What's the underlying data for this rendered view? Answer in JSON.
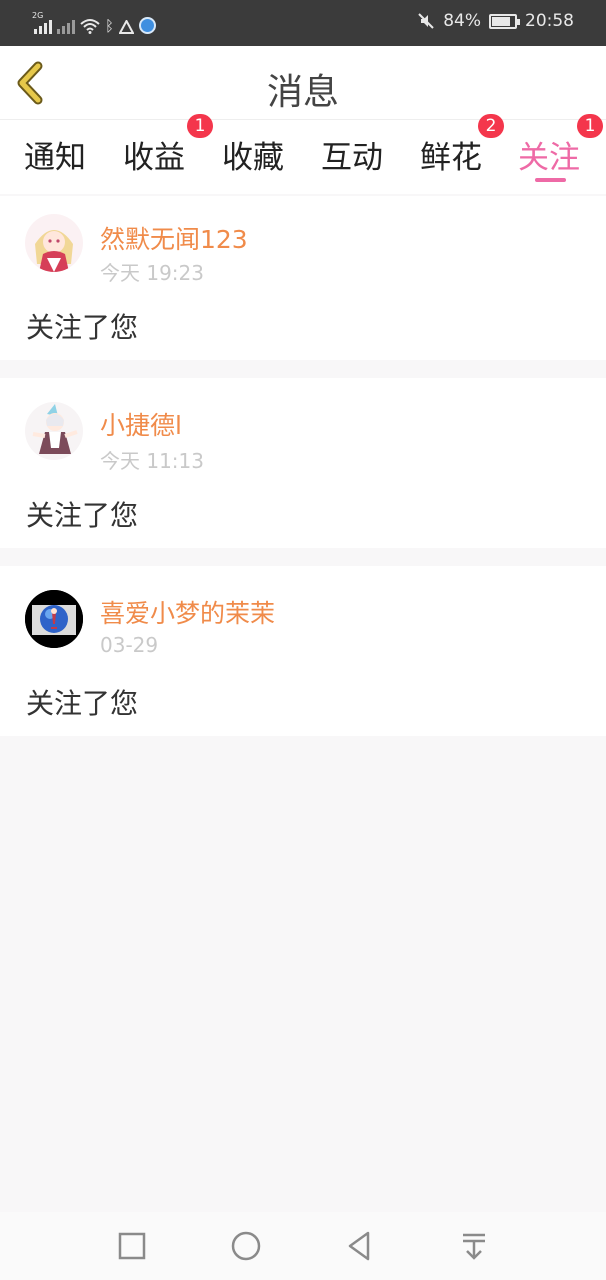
{
  "status_bar": {
    "network_tag": "2G",
    "battery_percent": "84%",
    "battery_level": 0.84,
    "time": "20:58",
    "icons": [
      "signal-icon",
      "signal-off-icon",
      "wifi-icon",
      "bluetooth-icon",
      "alert-icon",
      "app-notification-icon",
      "mute-icon",
      "battery-icon"
    ]
  },
  "header": {
    "title": "消息",
    "back_icon": "chevron-left-icon"
  },
  "tabs": [
    {
      "label": "通知",
      "badge": ""
    },
    {
      "label": "收益",
      "badge": "1"
    },
    {
      "label": "收藏",
      "badge": ""
    },
    {
      "label": "互动",
      "badge": ""
    },
    {
      "label": "鲜花",
      "badge": "2"
    },
    {
      "label": "关注",
      "badge": "1",
      "active": true
    }
  ],
  "notifications": [
    {
      "username": "然默无闻123",
      "time": "今天 19:23",
      "message": "关注了您"
    },
    {
      "username": "小捷德l",
      "time": "今天 11:13",
      "message": "关注了您"
    },
    {
      "username": "喜爱小梦的茉茉",
      "time": "03-29",
      "message": "关注了您"
    }
  ],
  "nav_bar": {
    "icons": [
      "recent-apps-icon",
      "home-icon",
      "back-icon",
      "notification-drawer-icon"
    ]
  },
  "colors": {
    "accent": "#ee6aa6",
    "username": "#f08b4a",
    "badge": "#f4364c",
    "back_arrow": "#e6c84a",
    "status_bar": "#3b3b3b"
  }
}
